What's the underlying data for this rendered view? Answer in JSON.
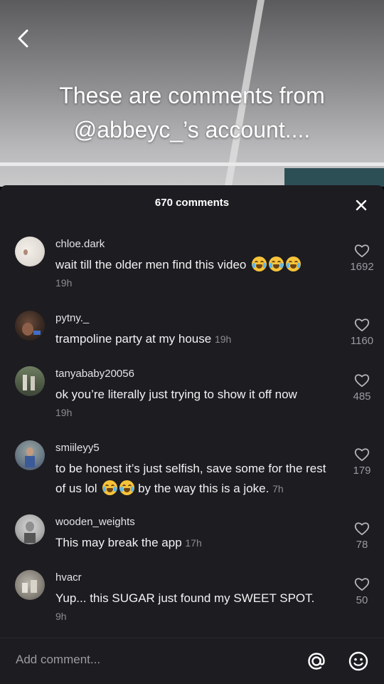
{
  "video": {
    "overlay_lines": [
      "These are comments from",
      "@abbeyc_’s account...."
    ]
  },
  "sheet": {
    "count_label": "670 comments",
    "comments": [
      {
        "username": "chloe.dark",
        "text": "wait till the older men find this video",
        "emoji": "crying-emoji x3",
        "time": "19h",
        "likes": "1692"
      },
      {
        "username": "pytny._",
        "text": "trampoline party at my house",
        "time": "19h",
        "likes": "1160"
      },
      {
        "username": "tanyababy20056",
        "text": "ok you’re literally just trying to show it off now",
        "time": "19h",
        "likes": "485"
      },
      {
        "username": "smiileyy5",
        "text_part1": "to be honest it’s just selfish, save some for the rest of us lol",
        "emoji": "laughing-emoji x2",
        "text_part2": "by the way this is a joke.",
        "time": "7h",
        "likes": "179"
      },
      {
        "username": "wooden_weights",
        "text": "This may break the app",
        "time": "17h",
        "likes": "78"
      },
      {
        "username": "hvacr",
        "text": "Yup... this SUGAR just found my SWEET SPOT.",
        "time": "9h",
        "likes": "50"
      }
    ]
  },
  "input": {
    "placeholder": "Add comment..."
  },
  "colors": {
    "sheet_bg": "#1d1c21",
    "text": "#f2f2f3",
    "muted": "#8c8c91"
  }
}
